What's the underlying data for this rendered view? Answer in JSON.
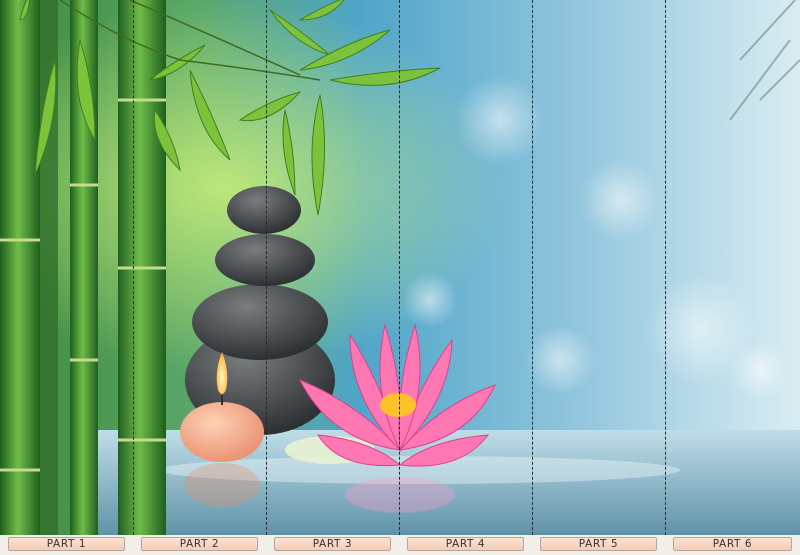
{
  "parts": [
    "PART 1",
    "PART 2",
    "PART 3",
    "PART 4",
    "PART 5",
    "PART 6"
  ],
  "colors": {
    "label_bg": "#f4cdb6",
    "label_border": "#b8a69a",
    "label_text": "#333333",
    "lotus": "#ff5fa6",
    "bamboo": "#4a9b3a",
    "water": "#9fc6d6"
  },
  "scene": {
    "elements": [
      "bamboo",
      "stacked-stones",
      "candle",
      "lotus-flower",
      "water",
      "bokeh-background"
    ]
  }
}
